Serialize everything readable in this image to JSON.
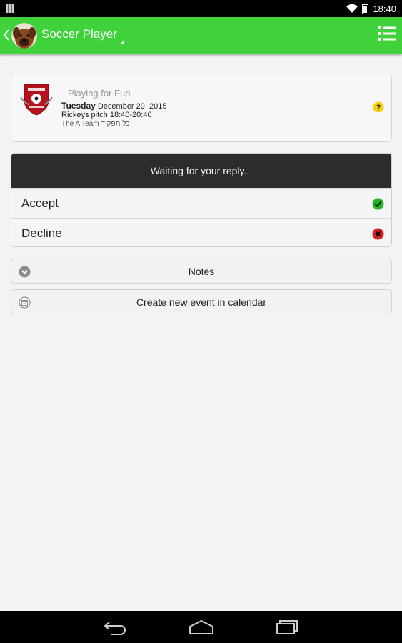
{
  "status_bar": {
    "time": "18:40",
    "icons": [
      "notification-icon",
      "wifi-icon",
      "battery-icon"
    ]
  },
  "header": {
    "title": "Soccer Player",
    "icons": [
      "back-chevron-icon",
      "avatar",
      "menu-list-icon"
    ],
    "background_color": "#3fd23a"
  },
  "event": {
    "name": "Playing for Fun",
    "day": "Tuesday",
    "date": "December 29, 2015",
    "location_time": "Rickeys pitch 18:40-20:40",
    "team_line": "The A Team כל תפקיד",
    "help_icon": "question-icon"
  },
  "reply": {
    "header": "Waiting for your reply...",
    "options": [
      {
        "label": "Accept",
        "icon": "check-circle-icon",
        "color": "#22b422"
      },
      {
        "label": "Decline",
        "icon": "x-circle-icon",
        "color": "#e01b1b"
      }
    ]
  },
  "actions": {
    "notes_label": "Notes",
    "calendar_label": "Create new event in calendar"
  },
  "nav_bar": {
    "icons": [
      "back-nav-icon",
      "home-nav-icon",
      "recents-nav-icon"
    ]
  }
}
